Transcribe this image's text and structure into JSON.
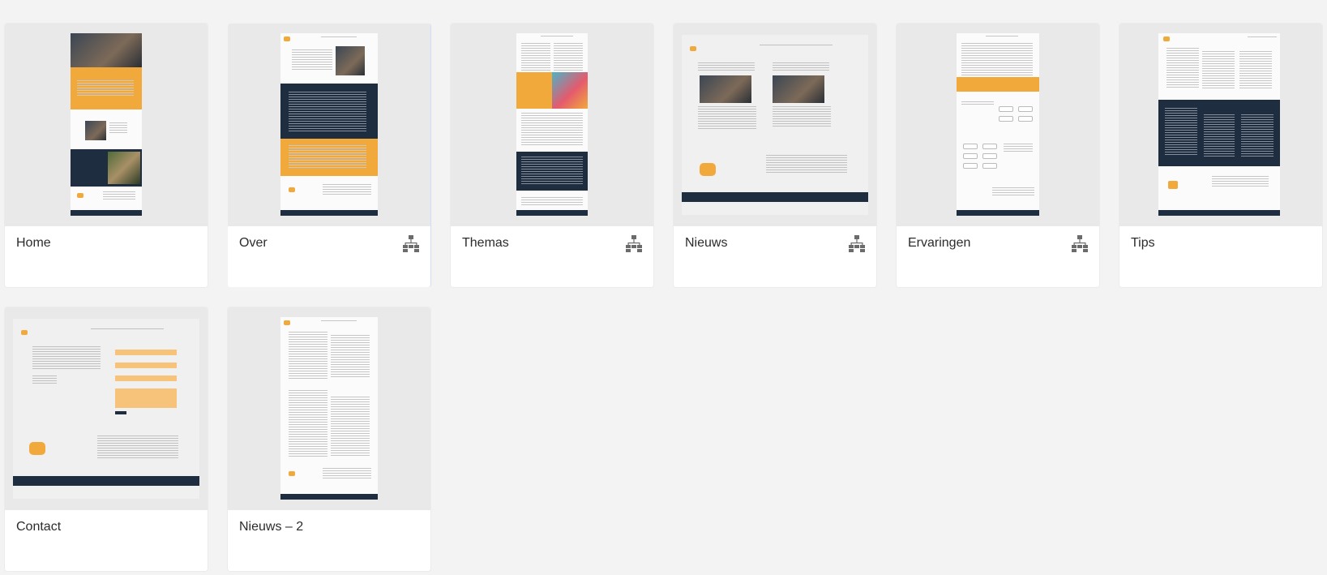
{
  "artboards": [
    {
      "label": "Home",
      "has_flow": false
    },
    {
      "label": "Over",
      "has_flow": true
    },
    {
      "label": "Themas",
      "has_flow": true
    },
    {
      "label": "Nieuws",
      "has_flow": true
    },
    {
      "label": "Ervaringen",
      "has_flow": true
    },
    {
      "label": "Tips",
      "has_flow": false
    },
    {
      "label": "Contact",
      "has_flow": false
    },
    {
      "label": "Nieuws – 2",
      "has_flow": false
    }
  ],
  "colors": {
    "background": "#f3f3f3",
    "card": "#ffffff",
    "thumb_bg": "#e9e9e9",
    "accent_orange": "#f2a93b",
    "navy": "#1f2d40",
    "icon": "#6b6b6b"
  },
  "icons": {
    "flow": "sitemap-icon"
  }
}
